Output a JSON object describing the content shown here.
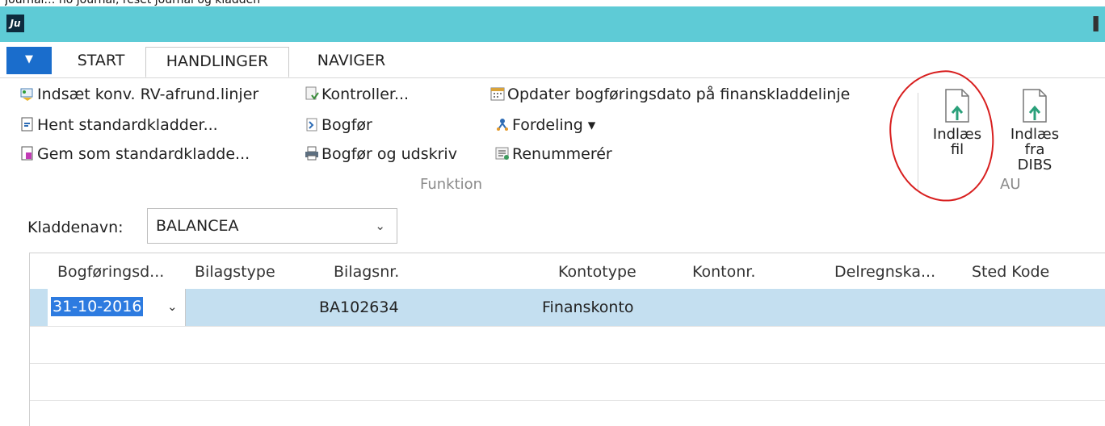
{
  "caption": "Journal… no journal, reset journal og kladden",
  "app": {
    "logo_text": "Ju"
  },
  "tabs": [
    {
      "label": "START"
    },
    {
      "label": "HANDLINGER"
    },
    {
      "label": "NAVIGER"
    }
  ],
  "ribbon": {
    "group1": [
      "Indsæt konv. RV-afrund.linjer",
      "Hent standardkladder...",
      "Gem som standardkladde..."
    ],
    "group2": [
      "Kontroller...",
      "Bogfør",
      "Bogfør og udskriv"
    ],
    "group3": [
      "Opdater bogføringsdato på finanskladdelinje",
      "Fordeling ▾",
      "Renummerér"
    ],
    "group_label_funktion": "Funktion",
    "big_buttons": [
      {
        "label_line1": "Indlæs",
        "label_line2": "fil"
      },
      {
        "label_line1": "Indlæs fra",
        "label_line2": "DIBS"
      }
    ],
    "group_label_au": "AU"
  },
  "journal": {
    "label": "Kladdenavn:",
    "value": "BALANCEA"
  },
  "grid": {
    "columns": [
      "Bogføringsd...",
      "Bilagstype",
      "Bilagsnr.",
      "Kontotype",
      "Kontonr.",
      "Delregnska...",
      "Sted Kode"
    ],
    "rows": [
      {
        "date": "31-10-2016",
        "bilagstype": "",
        "bilagsnr": "BA102634",
        "kontotype": "Finanskonto",
        "kontonr": "",
        "delregnskab": "",
        "sted": ""
      }
    ]
  },
  "colors": {
    "titlebar": "#5ecbd6",
    "menu_button": "#1a6dcc",
    "row_selected": "#c4dff0",
    "annotation": "#d81f1f"
  }
}
